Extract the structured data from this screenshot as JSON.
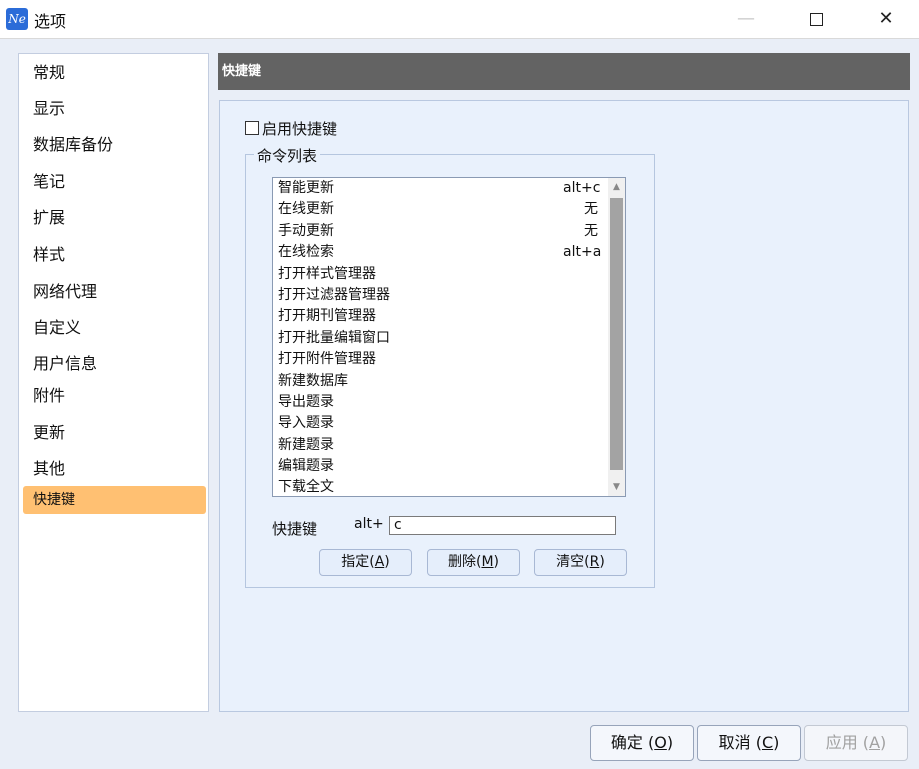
{
  "window": {
    "icon_text": "Ne",
    "title": "选项",
    "minimize_glyph": "—",
    "close_glyph": "✕"
  },
  "sidebar": {
    "items": [
      {
        "label": "常规"
      },
      {
        "label": "显示"
      },
      {
        "label": "数据库备份"
      },
      {
        "label": "笔记"
      },
      {
        "label": "扩展"
      },
      {
        "label": "样式"
      },
      {
        "label": "网络代理"
      },
      {
        "label": "自定义"
      },
      {
        "label": "用户信息"
      },
      {
        "label": "附件"
      },
      {
        "label": "更新"
      },
      {
        "label": "其他"
      },
      {
        "label": "快捷键",
        "active": true
      }
    ]
  },
  "main": {
    "header": "快捷键",
    "enable_label": "启用快捷键",
    "enable_checked": false,
    "group_title": "命令列表",
    "commands": [
      {
        "name": "智能更新",
        "key": "alt+c"
      },
      {
        "name": "在线更新",
        "key": "无"
      },
      {
        "name": "手动更新",
        "key": "无"
      },
      {
        "name": "在线检索",
        "key": "alt+a"
      },
      {
        "name": "打开样式管理器",
        "key": ""
      },
      {
        "name": "打开过滤器管理器",
        "key": ""
      },
      {
        "name": "打开期刊管理器",
        "key": ""
      },
      {
        "name": "打开批量编辑窗口",
        "key": ""
      },
      {
        "name": "打开附件管理器",
        "key": ""
      },
      {
        "name": "新建数据库",
        "key": ""
      },
      {
        "name": "导出题录",
        "key": ""
      },
      {
        "name": "导入题录",
        "key": ""
      },
      {
        "name": "新建题录",
        "key": ""
      },
      {
        "name": "编辑题录",
        "key": ""
      },
      {
        "name": "下载全文",
        "key": ""
      }
    ],
    "hotkey_label": "快捷键",
    "hotkey_prefix": "alt+",
    "hotkey_value": "c",
    "buttons": {
      "assign": {
        "text": "指定(",
        "mnemonic": "A",
        "close": ")"
      },
      "delete": {
        "text": "删除(",
        "mnemonic": "M",
        "close": ")"
      },
      "clear": {
        "text": "清空(",
        "mnemonic": "R",
        "close": ")"
      }
    }
  },
  "footer": {
    "ok": {
      "text": "确定 (",
      "mnemonic": "O",
      "close": ")"
    },
    "cancel": {
      "text": "取消 (",
      "mnemonic": "C",
      "close": ")"
    },
    "apply": {
      "text": "应用 (",
      "mnemonic": "A",
      "close": ")",
      "disabled": true
    }
  }
}
